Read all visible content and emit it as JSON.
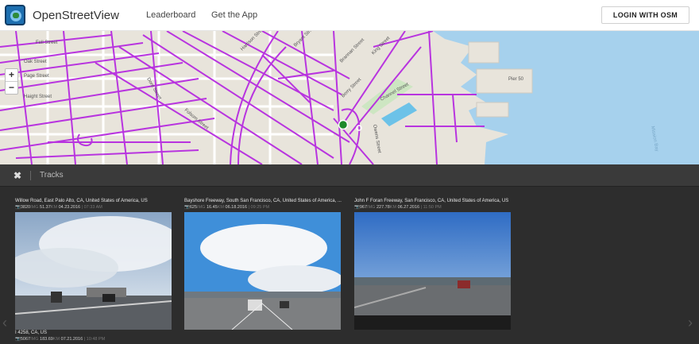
{
  "header": {
    "brand": "OpenStreetView",
    "nav": [
      "Leaderboard",
      "Get the App"
    ],
    "login_label": "LOGIN WITH OSM"
  },
  "map": {
    "zoom_in": "+",
    "zoom_out": "−",
    "street_labels": [
      "Oak Street",
      "Page Street",
      "Haight Street",
      "Fell Street",
      "Dore Street",
      "Folsom Street",
      "Harrison Street",
      "Bryant Street",
      "Brannan Street",
      "King Street",
      "Berry Street",
      "Channel Street",
      "Owens Street",
      "Pier 50",
      "Mission Bay"
    ],
    "track_color": "#b62be0",
    "water_color": "#a6d1ed"
  },
  "panel": {
    "close_label": "✖",
    "title": "Tracks"
  },
  "tracks": [
    {
      "location": "Willow Road, East Palo Alto, CA, United States of America, US",
      "photos": "3820",
      "distance": "51.37",
      "date": "04.23.2016",
      "time": "07:33 AM",
      "photos_unit": "IMG",
      "distance_unit": "KM"
    },
    {
      "location": "Bayshore Freeway, South San Francisco, CA, United States of America, ...",
      "photos": "625",
      "distance": "16.45",
      "date": "06.18.2016",
      "time": "09:25 PM",
      "photos_unit": "IMG",
      "distance_unit": "KM"
    },
    {
      "location": "John F Foran Freeway, San Francisco, CA, United States of America, US",
      "photos": "967",
      "distance": "227.78",
      "date": "06.27.2016",
      "time": "11:50 PM",
      "photos_unit": "IMG",
      "distance_unit": "KM"
    }
  ],
  "bottom_track": {
    "location": "I 4258, CA, US",
    "photos": "5067",
    "distance": "183.69",
    "date": "07.21.2016",
    "time": "10:48 PM",
    "photos_unit": "IMG",
    "distance_unit": "KM"
  },
  "icons": {
    "prev": "‹",
    "next": "›",
    "camera": "📷"
  }
}
